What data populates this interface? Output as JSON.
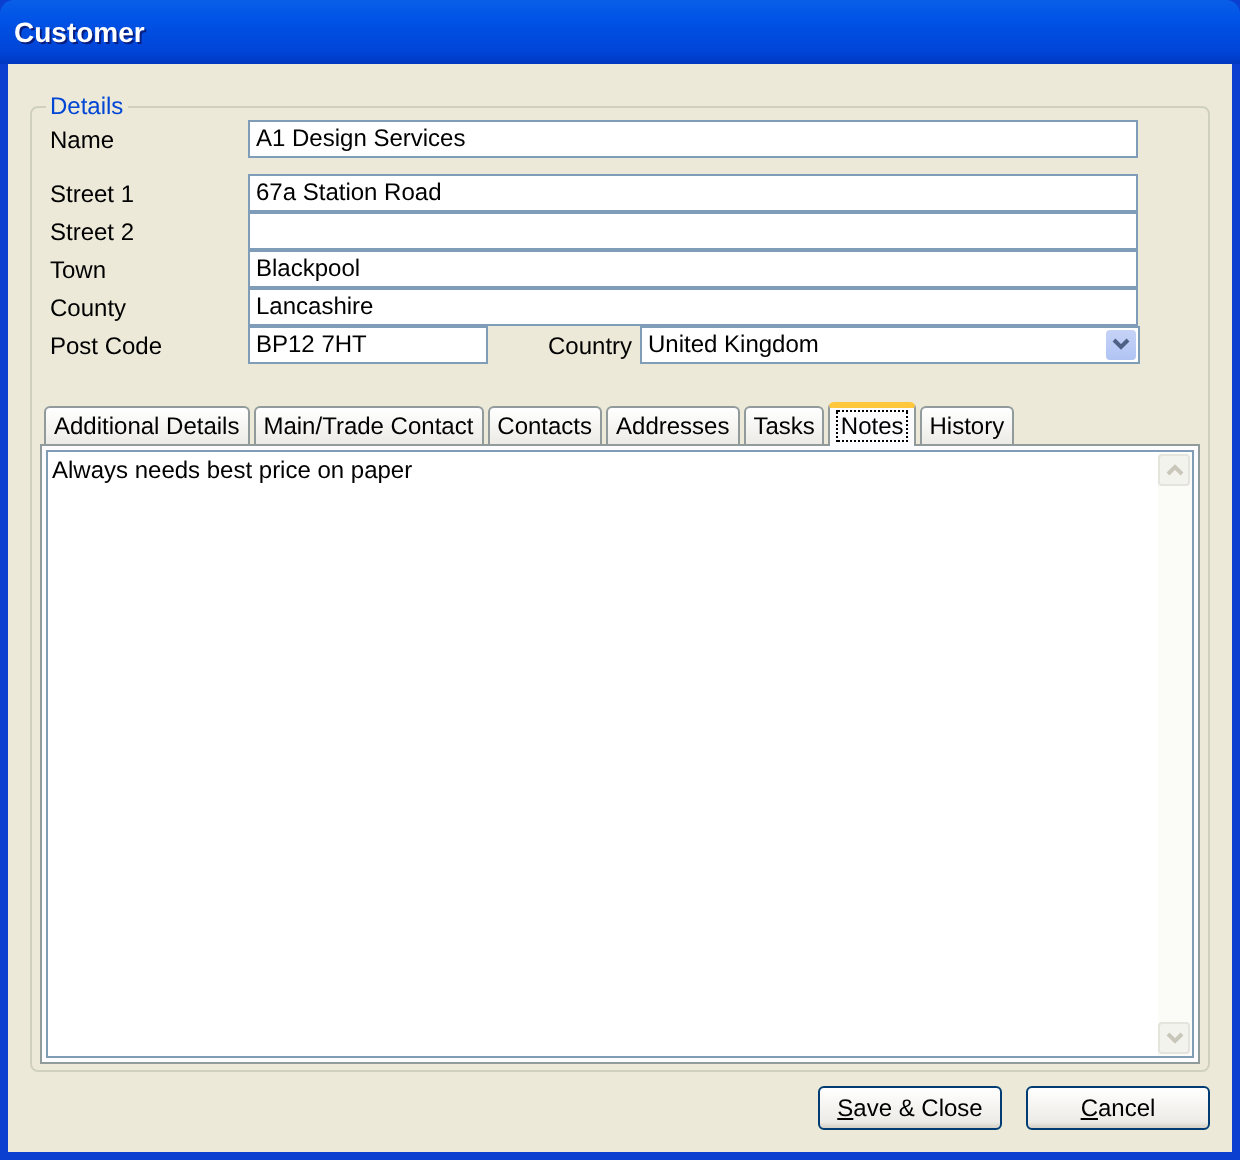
{
  "window": {
    "title": "Customer"
  },
  "details": {
    "title": "Details",
    "fields": [
      {
        "label": "Name",
        "value": "A1 Design Services"
      },
      {
        "label": "Street 1",
        "value": "67a Station Road"
      },
      {
        "label": "Street 2"
      },
      {
        "label": "Town",
        "value": "Blackpool"
      },
      {
        "label": "County",
        "value": "Lancashire"
      },
      {
        "label": "Post Code",
        "value": "BP12 7HT"
      }
    ],
    "country": {
      "label": "Country",
      "value": "United Kingdom"
    }
  },
  "tabs": [
    {
      "label": "Additional Details",
      "selected": false
    },
    {
      "label": "Main/Trade Contact",
      "selected": false
    },
    {
      "label": "Contacts",
      "selected": false
    },
    {
      "label": "Addresses",
      "selected": false
    },
    {
      "label": "Tasks",
      "selected": false
    },
    {
      "label": "Notes",
      "selected": true
    },
    {
      "label": "History",
      "selected": false
    }
  ],
  "notes": {
    "value": "Always needs best price on paper"
  },
  "buttons": [
    {
      "label": "Save & Close",
      "first_letter_underlined": true
    },
    {
      "label": "Cancel",
      "first_letter_underlined": true
    }
  ]
}
